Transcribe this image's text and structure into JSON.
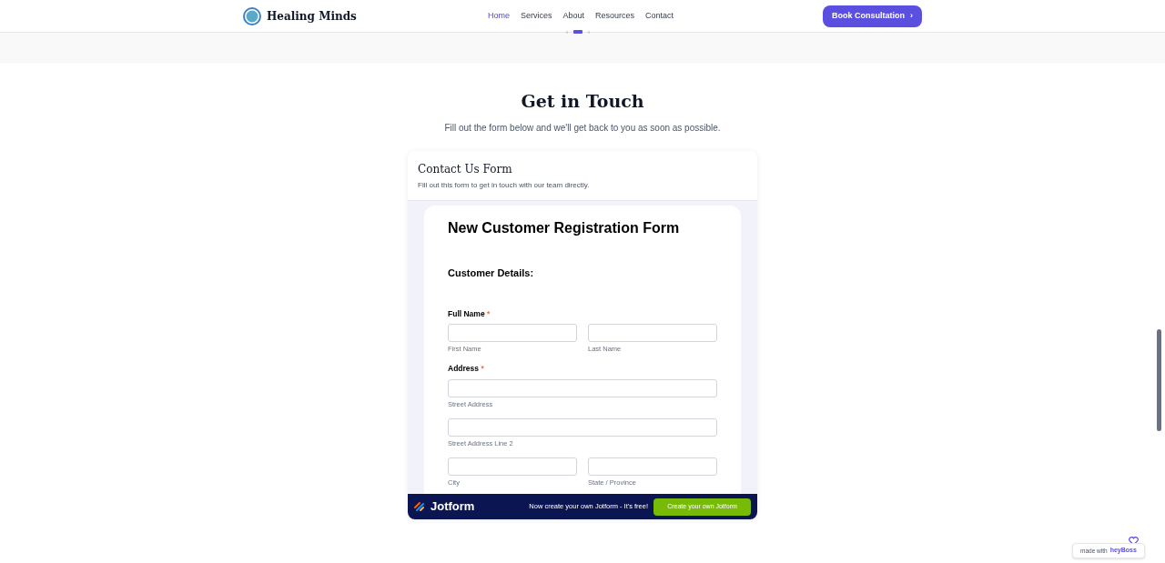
{
  "header": {
    "brand": "Healing Minds",
    "nav": [
      {
        "label": "Home",
        "selected": true
      },
      {
        "label": "Services",
        "selected": false
      },
      {
        "label": "About",
        "selected": false
      },
      {
        "label": "Resources",
        "selected": false
      },
      {
        "label": "Contact",
        "selected": false
      }
    ],
    "cta": "Book Consultation",
    "cta_icon": "›"
  },
  "section": {
    "title": "Get in Touch",
    "subtitle": "Fill out the form below and we'll get back to you as soon as possible."
  },
  "card": {
    "title": "Contact Us Form",
    "description": "Fill out this form to get in touch with our team directly."
  },
  "form": {
    "title": "New Customer Registration Form",
    "section": "Customer Details:",
    "groups": [
      {
        "label": "Full Name",
        "required_mark": "*",
        "rows": [
          [
            "First Name",
            "Last Name"
          ]
        ]
      },
      {
        "label": "Address",
        "required_mark": "*",
        "rows": [
          [
            "Street Address"
          ],
          [
            "Street Address Line 2"
          ],
          [
            "City",
            "State / Province"
          ]
        ]
      }
    ]
  },
  "jotform_bar": {
    "brand": "Jotform",
    "promo": "Now create your own Jotform - It's free!",
    "button": "Create your own Jotform"
  },
  "badge": {
    "prefix": "made with",
    "brand": "heyBoss"
  }
}
